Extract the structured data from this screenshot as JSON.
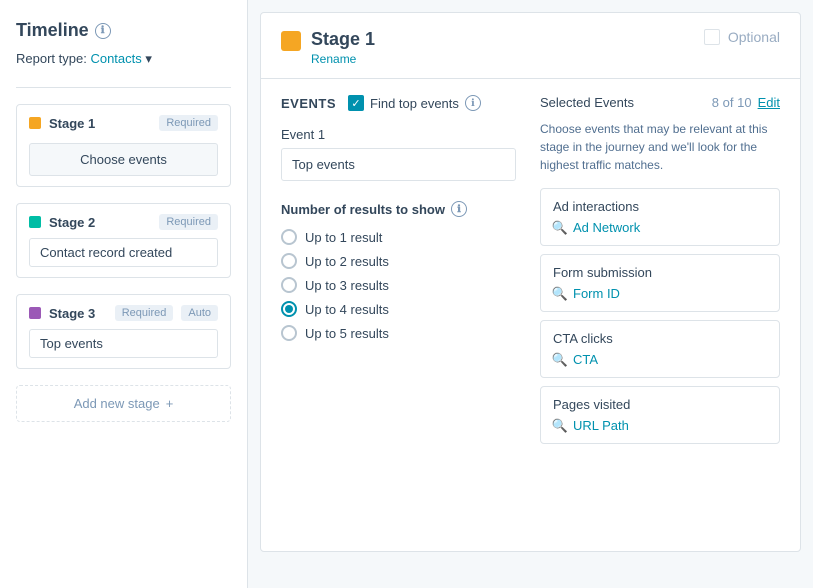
{
  "sidebar": {
    "title": "Timeline",
    "report_type_label": "Report type:",
    "report_type_value": "Contacts",
    "stages": [
      {
        "id": "stage1",
        "label": "Stage 1",
        "dot_class": "orange",
        "badge": "Required",
        "auto": false,
        "value": null,
        "has_choose_events": true
      },
      {
        "id": "stage2",
        "label": "Stage 2",
        "dot_class": "teal",
        "badge": "Required",
        "auto": false,
        "value": "Contact record created",
        "has_choose_events": false
      },
      {
        "id": "stage3",
        "label": "Stage 3",
        "dot_class": "purple",
        "badge": "Required",
        "auto": true,
        "value": "Top events",
        "has_choose_events": false
      }
    ],
    "add_stage_label": "Add new stage"
  },
  "main": {
    "stage_title": "Stage 1",
    "rename_label": "Rename",
    "optional_label": "Optional",
    "events_title": "EVENTS",
    "find_top_events_label": "Find top events",
    "event_label": "Event 1",
    "event_value": "Top events",
    "results_title": "Number of results to show",
    "results_options": [
      {
        "label": "Up to 1 result",
        "selected": false
      },
      {
        "label": "Up to 2 results",
        "selected": false
      },
      {
        "label": "Up to 3 results",
        "selected": false
      },
      {
        "label": "Up to 4 results",
        "selected": true
      },
      {
        "label": "Up to 5 results",
        "selected": false
      }
    ],
    "selected_events_title": "Selected Events",
    "selected_count": "8",
    "selected_total": "10",
    "edit_label": "Edit",
    "selected_events_desc": "Choose events that may be relevant at this stage in the journey and we'll look for the highest traffic matches.",
    "event_items": [
      {
        "name": "Ad interactions",
        "filter_label": "Ad Network"
      },
      {
        "name": "Form submission",
        "filter_label": "Form ID"
      },
      {
        "name": "CTA clicks",
        "filter_label": "CTA"
      },
      {
        "name": "Pages visited",
        "filter_label": "URL Path"
      }
    ]
  },
  "icons": {
    "info": "ℹ",
    "plus": "+",
    "search": "🔍",
    "check": "✓"
  }
}
